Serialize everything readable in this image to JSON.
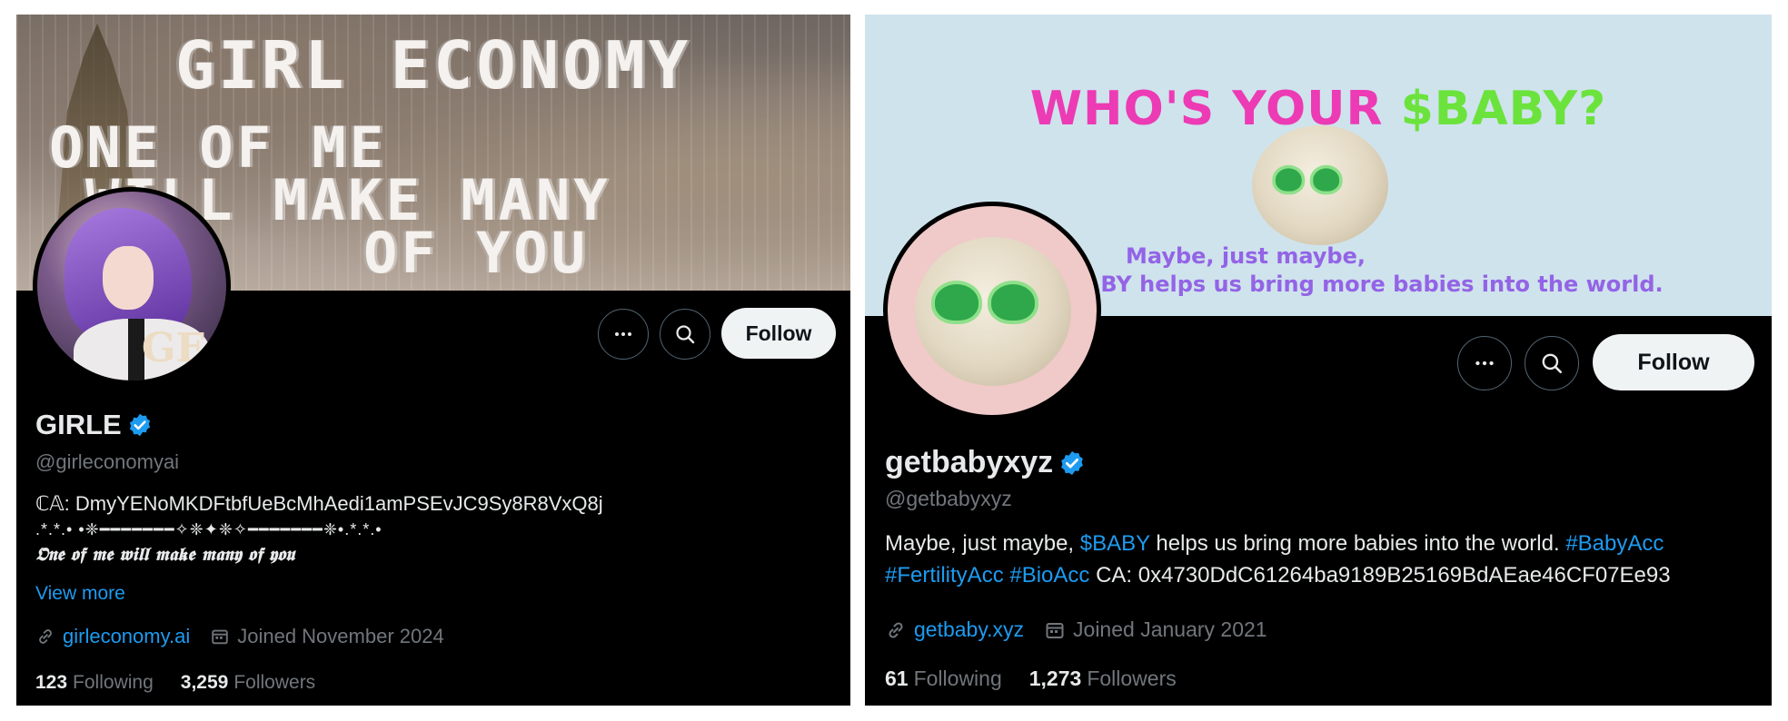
{
  "profiles": [
    {
      "banner": {
        "title": "GIRL ECONOMY",
        "line1": "ONE OF ME",
        "line2": "WILL MAKE MANY",
        "line3": "OF YOU"
      },
      "avatar_mark": "GE",
      "display_name": "GIRLE",
      "handle": "@girleconomyai",
      "bio": {
        "ca_prefix": "ℂ𝔸: ",
        "ca_value": "DmyYENoMKDFtbfUeBcMhAedi1amPSEvJC9Sy8R8VxQ8j",
        "decor": ".*.*.• •❈━━━━━━━✧❈✦❈✧━━━━━━━❈•.*.*.•",
        "tagline": "𝕺𝖓𝖊 𝖔𝖋 𝖒𝖊 𝖜𝖎𝖑𝖑 𝖒𝖆𝖐𝖊 𝖒𝖆𝖓𝖞 𝖔𝖋 𝖞𝖔𝖚"
      },
      "view_more": "View more",
      "website": "girleconomy.ai",
      "joined": "Joined November 2024",
      "following_count": "123",
      "following_label": "Following",
      "followers_count": "3,259",
      "followers_label": "Followers",
      "follow_label": "Follow"
    },
    {
      "banner": {
        "headline_a": "WHO'S YOUR ",
        "headline_b": "$BABY?",
        "maybe": "Maybe, just maybe,",
        "helps": "BY helps us bring more babies into the world."
      },
      "display_name": "getbabyxyz",
      "handle": "@getbabyxyz",
      "bio": {
        "text1": "Maybe, just maybe, ",
        "cashtag": "$BABY",
        "text2": " helps us bring more babies into the world. ",
        "tag1": "#BabyAcc",
        "tag2": "#FertilityAcc",
        "tag3": "#BioAcc",
        "ca": " CA: 0x4730DdC61264ba9189B25169BdAEae46CF07Ee93"
      },
      "website": "getbaby.xyz",
      "joined": "Joined January 2021",
      "following_count": "61",
      "following_label": "Following",
      "followers_count": "1,273",
      "followers_label": "Followers",
      "follow_label": "Follow"
    }
  ],
  "colors": {
    "link": "#1d9bf0",
    "muted": "#71767b",
    "headline_pink": "#ec3bb4",
    "headline_green": "#6be33c",
    "banner_purple_text": "#9364e6"
  },
  "icons": [
    "more-icon",
    "search-icon",
    "verified-badge-icon",
    "link-icon",
    "calendar-icon"
  ]
}
